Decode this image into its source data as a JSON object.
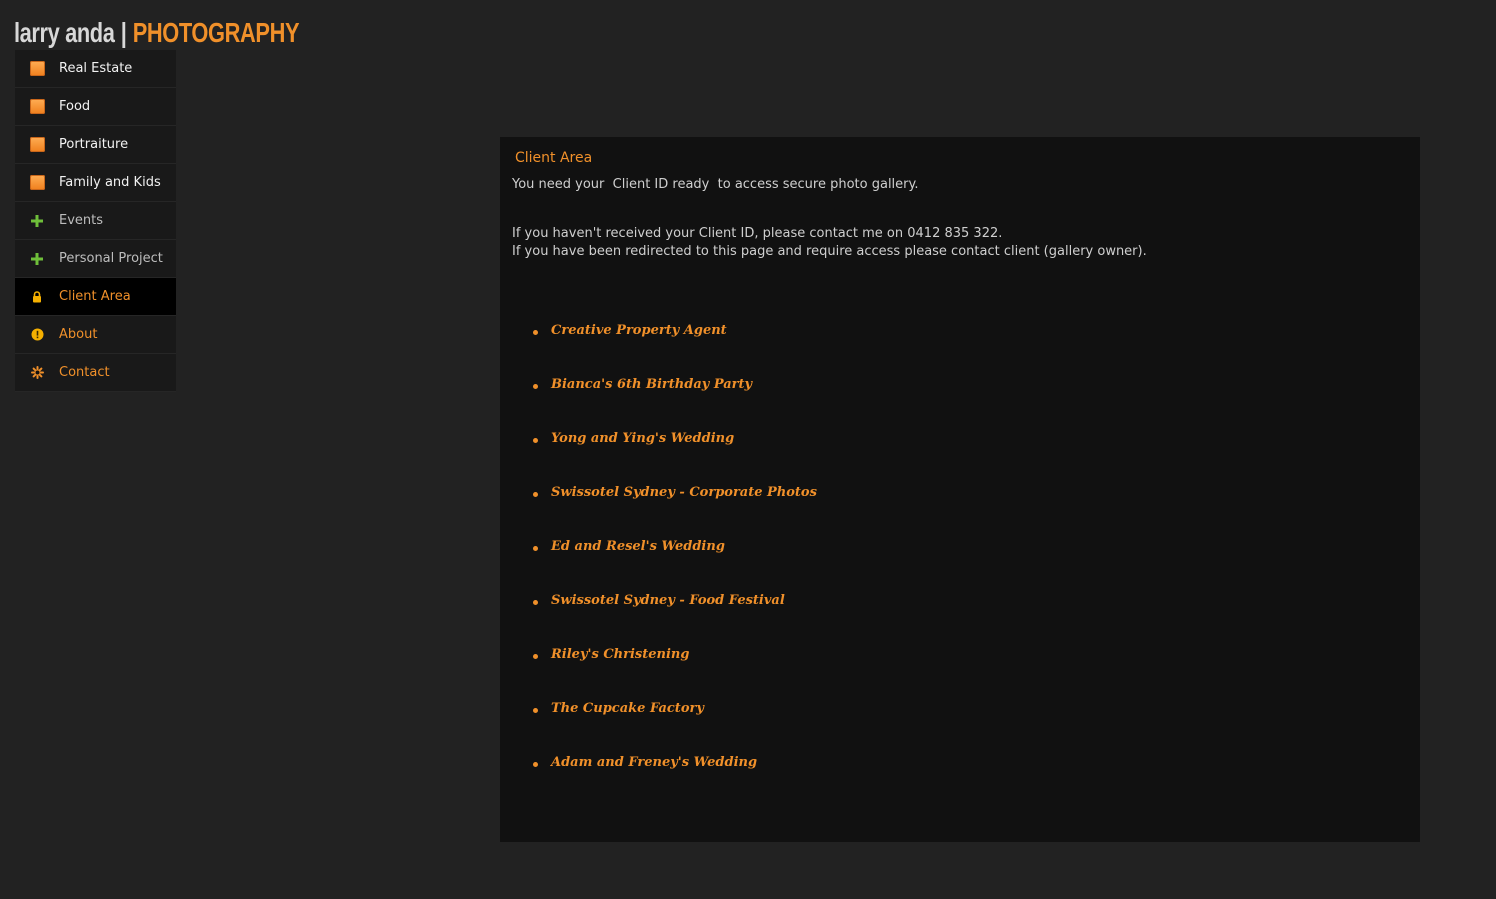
{
  "logo": {
    "name": "larry anda",
    "separator": "|",
    "brand": "PHOTOGRAPHY"
  },
  "nav": {
    "items": [
      {
        "label": "Real Estate",
        "icon": "orange-square-icon"
      },
      {
        "label": "Food",
        "icon": "orange-square-icon"
      },
      {
        "label": "Portraiture",
        "icon": "orange-square-icon"
      },
      {
        "label": "Family and Kids",
        "icon": "orange-square-icon"
      },
      {
        "label": "Events",
        "icon": "green-plus-icon"
      },
      {
        "label": "Personal Project",
        "icon": "green-plus-icon"
      },
      {
        "label": "Client Area",
        "icon": "lock-icon",
        "active": true
      },
      {
        "label": "About",
        "icon": "info-icon"
      },
      {
        "label": "Contact",
        "icon": "asterisk-icon"
      }
    ]
  },
  "client_area": {
    "title": "Client Area",
    "intro": "You need your  Client ID ready  to access secure photo gallery.",
    "contact_line_1": "If you haven't received your Client ID, please contact me on 0412 835 322.",
    "contact_line_2": "If you have been redirected to this page and require access please contact client (gallery owner).",
    "galleries": [
      "Creative Property Agent",
      "Bianca's 6th Birthday Party",
      "Yong and Ying's Wedding",
      "Swissotel Sydney - Corporate Photos",
      "Ed and Resel's Wedding",
      "Swissotel Sydney - Food Festival",
      "Riley's Christening",
      "The Cupcake Factory",
      "Adam and Freney's Wedding"
    ]
  },
  "colors": {
    "background": "#222222",
    "panel": "#111111",
    "accent_orange": "#f0902a",
    "plus_green": "#6fbf3a"
  }
}
